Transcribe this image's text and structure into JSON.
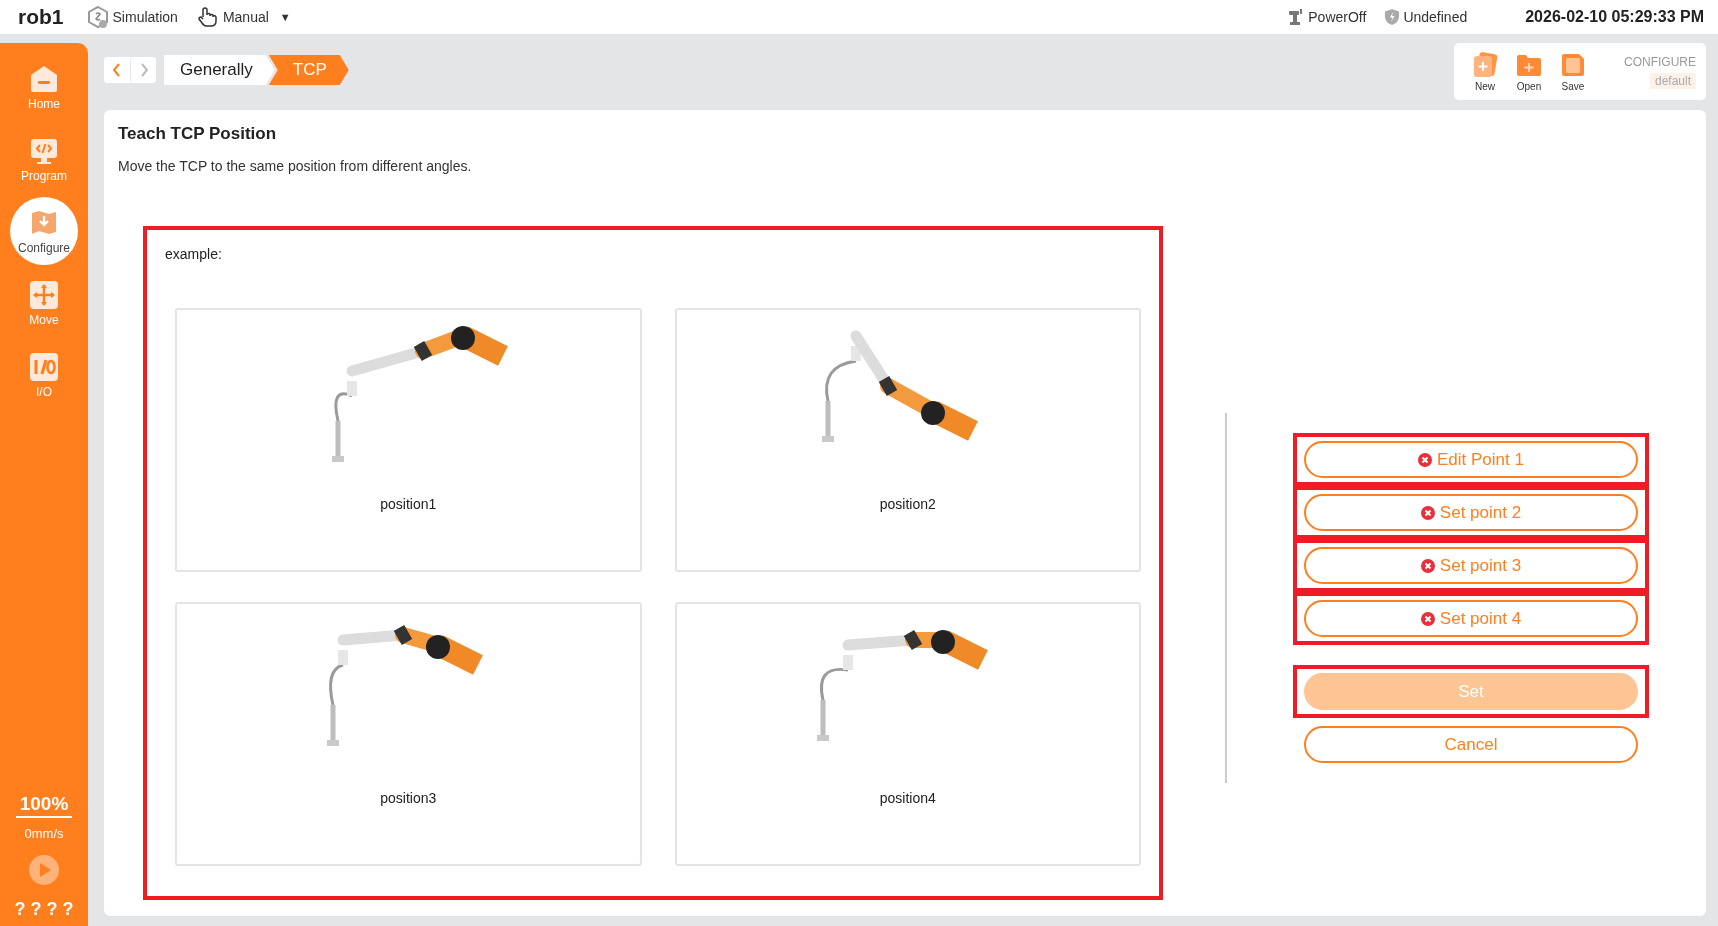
{
  "topbar": {
    "robot": "rob1",
    "mode": "Simulation",
    "control": "Manual",
    "caret": "▼",
    "power": "PowerOff",
    "safety": "Undefined",
    "datetime": "2026-02-10 05:29:33 PM"
  },
  "sidebar": {
    "items": [
      {
        "label": "Home",
        "kind": "home",
        "selected": false
      },
      {
        "label": "Program",
        "kind": "program",
        "selected": false
      },
      {
        "label": "Configure",
        "kind": "configure",
        "selected": true
      },
      {
        "label": "Move",
        "kind": "move",
        "selected": false
      },
      {
        "label": "I/O",
        "kind": "io",
        "selected": false
      }
    ],
    "speed_percent": "100%",
    "speed": "0mm/s",
    "footer": "? ? ? ?"
  },
  "nav": {
    "back_disabled": false,
    "forward_disabled": true
  },
  "breadcrumb": [
    {
      "label": "Generally",
      "selected": false
    },
    {
      "label": "TCP",
      "selected": true
    }
  ],
  "toolbar": {
    "actions": [
      {
        "label": "New",
        "kind": "new"
      },
      {
        "label": "Open",
        "kind": "open"
      },
      {
        "label": "Save",
        "kind": "save"
      }
    ],
    "configure_label": "CONFIGURE",
    "configure_value": "default"
  },
  "panel": {
    "title": "Teach TCP Position",
    "description": "Move the TCP to the same position from different angles.",
    "example": {
      "label": "example:",
      "highlighted": true,
      "positions": [
        {
          "label": "position1"
        },
        {
          "label": "position2"
        },
        {
          "label": "position3"
        },
        {
          "label": "position4"
        }
      ]
    },
    "points": [
      {
        "label": "Edit Point 1",
        "error": true,
        "highlighted": true
      },
      {
        "label": "Set point 2",
        "error": true,
        "highlighted": true
      },
      {
        "label": "Set point 3",
        "error": true,
        "highlighted": true
      },
      {
        "label": "Set point 4",
        "error": true,
        "highlighted": true
      }
    ],
    "actions": [
      {
        "label": "Set",
        "kind": "primary",
        "disabled": true,
        "highlighted": true
      },
      {
        "label": "Cancel",
        "kind": "outline",
        "disabled": false,
        "highlighted": false
      }
    ]
  }
}
